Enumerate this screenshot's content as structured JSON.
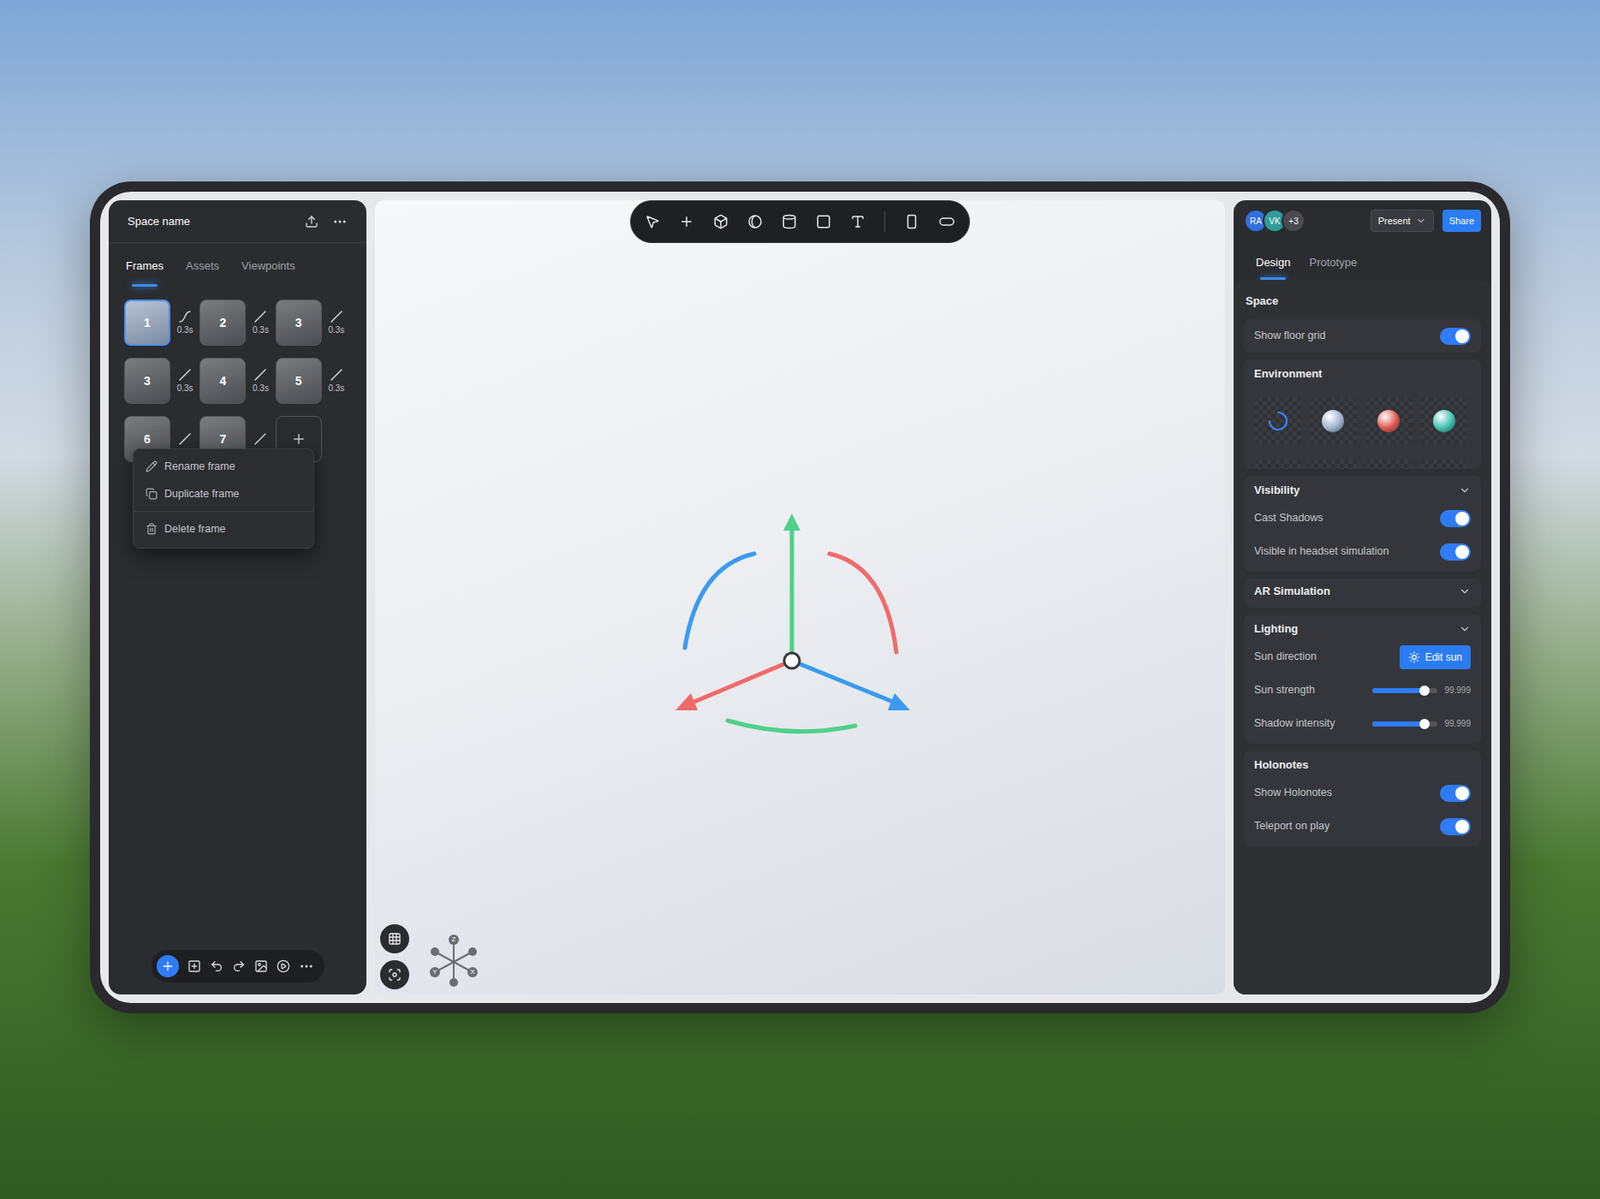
{
  "left_panel": {
    "space_name": "Space name",
    "tabs": [
      {
        "label": "Frames",
        "selected": true
      },
      {
        "label": "Assets",
        "selected": false
      },
      {
        "label": "Viewpoints",
        "selected": false
      }
    ],
    "frames": [
      {
        "number": "1",
        "selected": true,
        "transition": {
          "kind": "curve",
          "duration": "0.3s"
        }
      },
      {
        "number": "2",
        "selected": false,
        "transition": {
          "kind": "line",
          "duration": "0.3s"
        }
      },
      {
        "number": "3",
        "selected": false,
        "transition": {
          "kind": "line",
          "duration": "0.3s"
        }
      },
      {
        "number": "3",
        "selected": false,
        "transition": {
          "kind": "line",
          "duration": "0.3s"
        }
      },
      {
        "number": "4",
        "selected": false,
        "transition": {
          "kind": "line",
          "duration": "0.3s"
        }
      },
      {
        "number": "5",
        "selected": false,
        "transition": {
          "kind": "line",
          "duration": "0.3s"
        }
      },
      {
        "number": "6",
        "selected": false,
        "transition": {
          "kind": "line"
        }
      },
      {
        "number": "7",
        "selected": false,
        "transition": {
          "kind": "line"
        }
      }
    ],
    "context_menu": [
      {
        "label": "Rename frame",
        "divider_above": false
      },
      {
        "label": "Duplicate frame",
        "divider_above": false
      },
      {
        "label": "Delete frame",
        "divider_above": true
      }
    ]
  },
  "viewport": {
    "axes": [
      {
        "label": "Z"
      },
      {
        "label": "Y"
      },
      {
        "label": "X"
      }
    ]
  },
  "right_panel": {
    "collaborators": [
      {
        "initials": "RA",
        "color": "#2f6fde"
      },
      {
        "initials": "VK",
        "color": "#2f9c9a"
      }
    ],
    "more_collaborators": "+3",
    "present": "Present",
    "share": "Share",
    "tabs": [
      {
        "label": "Design",
        "selected": true
      },
      {
        "label": "Prototype",
        "selected": false
      }
    ],
    "space": {
      "title": "Space",
      "rows": [
        {
          "kind": "toggle",
          "label": "Show floor grid",
          "on": true
        }
      ]
    },
    "sections": [
      {
        "title": "Environment",
        "kind": "swatches",
        "collapsible": false,
        "expanded": true,
        "swatches": [
          {
            "kind": "spinner",
            "color": "#3b82f6"
          },
          {
            "kind": "sphere",
            "color": "#9fb3cf"
          },
          {
            "kind": "sphere",
            "color": "#e0574f"
          },
          {
            "kind": "sphere",
            "color": "#3fbfb0"
          },
          {
            "kind": "sphere",
            "color": "#3b4a63"
          },
          {
            "kind": "sphere",
            "color": "#2f4a78"
          },
          {
            "kind": "sphere",
            "color": "#3b82f6"
          },
          {
            "kind": "sphere",
            "color": "#8a3b2e"
          }
        ]
      },
      {
        "title": "Visibility",
        "kind": "rows",
        "collapsible": true,
        "expanded": true,
        "rows": [
          {
            "kind": "toggle",
            "label": "Cast Shadows",
            "on": true
          },
          {
            "kind": "toggle",
            "label": "Visible in headset simulation",
            "on": true
          }
        ]
      },
      {
        "title": "AR Simulation",
        "kind": "rows",
        "collapsible": true,
        "expanded": false,
        "rows": []
      },
      {
        "title": "Lighting",
        "kind": "rows",
        "collapsible": true,
        "expanded": true,
        "rows": [
          {
            "kind": "button",
            "label": "Sun direction",
            "button": "Edit sun"
          },
          {
            "kind": "slider",
            "label": "Sun strength",
            "level": 0.8,
            "reading": "99.999"
          },
          {
            "kind": "slider",
            "label": "Shadow intensity",
            "level": 0.8,
            "reading": "99.999"
          }
        ]
      },
      {
        "title": "Holonotes",
        "kind": "rows",
        "collapsible": false,
        "expanded": true,
        "rows": [
          {
            "kind": "toggle",
            "label": "Show Holonotes",
            "on": true
          },
          {
            "kind": "toggle",
            "label": "Teleport on play",
            "on": true
          }
        ]
      }
    ]
  }
}
